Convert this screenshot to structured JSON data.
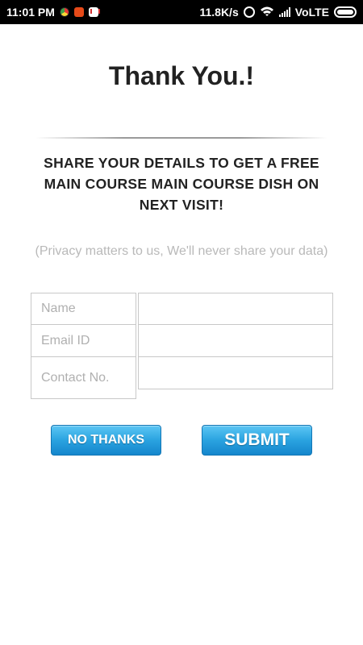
{
  "status_bar": {
    "time": "11:01 PM",
    "speed": "11.8K/s",
    "network": "VoLTE",
    "icons": [
      "chrome-icon",
      "mi-icon",
      "gmail-icon",
      "alarm-icon",
      "wifi-icon",
      "signal-icon",
      "battery-icon"
    ]
  },
  "page": {
    "title": "Thank You.!",
    "offer": "SHARE YOUR DETAILS TO GET A FREE MAIN COURSE MAIN COURSE DISH ON NEXT VISIT!",
    "privacy": "(Privacy matters to us, We'll never share your data)"
  },
  "form": {
    "fields": [
      {
        "label": "Name",
        "value": ""
      },
      {
        "label": "Email ID",
        "value": ""
      },
      {
        "label": "Contact No.",
        "value": ""
      }
    ]
  },
  "buttons": {
    "no_thanks": "NO THANKS",
    "submit": "SUBMIT"
  },
  "colors": {
    "button_top": "#5cc6f4",
    "button_bottom": "#1586cc",
    "title": "#222222",
    "privacy": "#b9b9b9"
  }
}
